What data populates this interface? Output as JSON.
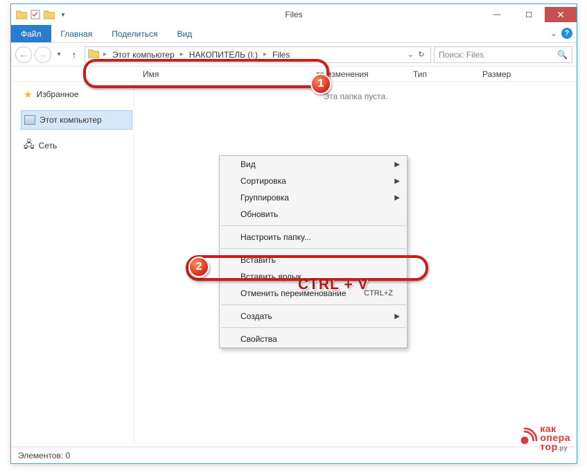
{
  "window": {
    "title": "Files"
  },
  "ribbon": {
    "file": "Файл",
    "home": "Главная",
    "share": "Поделиться",
    "view": "Вид"
  },
  "breadcrumbs": {
    "this_pc": "Этот компьютер",
    "drive": "НАКОПИТЕЛЬ (I:)",
    "folder": "Files"
  },
  "search": {
    "placeholder": "Поиск: Files"
  },
  "columns": {
    "name": "Имя",
    "date_modified": "та изменения",
    "type": "Тип",
    "size": "Размер"
  },
  "navpane": {
    "favorites": "Избранное",
    "this_pc": "Этот компьютер",
    "network": "Сеть"
  },
  "content": {
    "empty": "Эта папка пуста."
  },
  "context_menu": {
    "view": "Вид",
    "sort": "Сортировка",
    "group": "Группировка",
    "refresh": "Обновить",
    "customize": "Настроить папку...",
    "paste": "Вставить",
    "paste_shortcut": "Вставить ярлык",
    "undo_rename": "Отменить переименование",
    "undo_hotkey": "CTRL+Z",
    "create": "Создать",
    "properties": "Свойства"
  },
  "callouts": {
    "badge1": "1",
    "badge2": "2",
    "hotkey": "CTRL + V"
  },
  "statusbar": {
    "items": "Элементов: 0"
  },
  "watermark": {
    "line1": "как",
    "line2": "опера",
    "line3": "тор",
    "suffix": ".ру"
  }
}
